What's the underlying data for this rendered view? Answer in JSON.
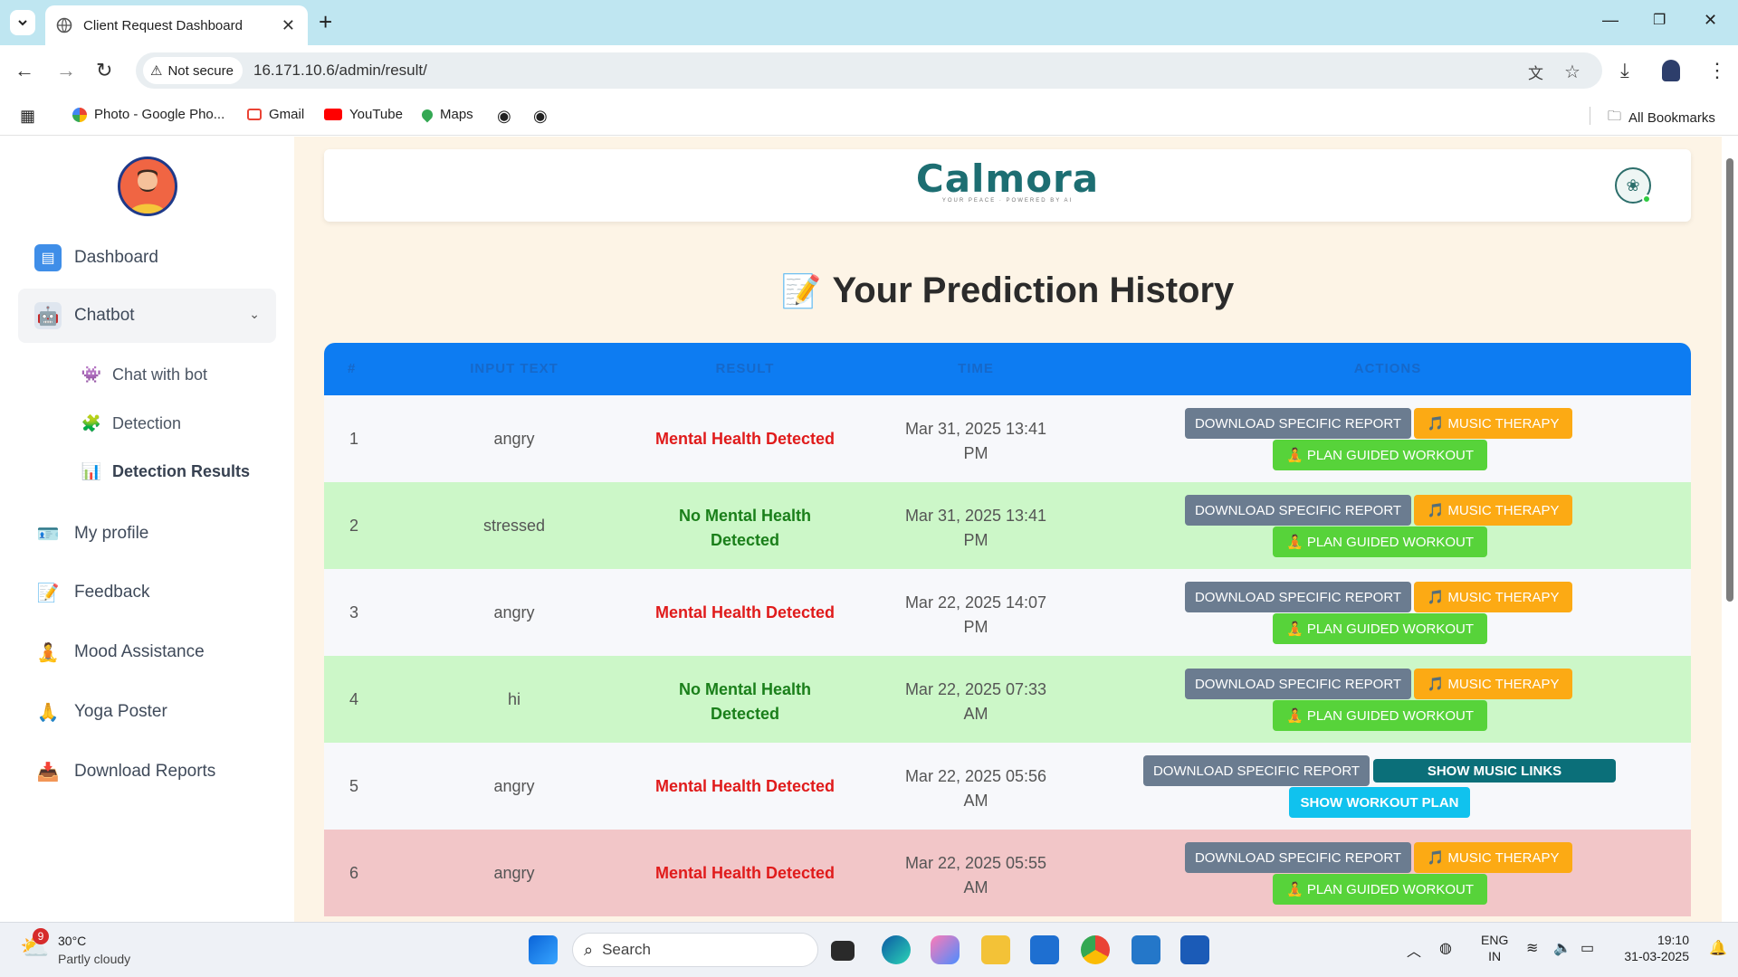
{
  "browser": {
    "tab_title": "Client Request Dashboard",
    "security_label": "Not secure",
    "url": "16.171.10.6/admin/result/",
    "bookmarks": [
      "Photo - Google Pho...",
      "Gmail",
      "YouTube",
      "Maps"
    ],
    "all_bookmarks": "All Bookmarks"
  },
  "sidebar": {
    "items": [
      {
        "label": "Dashboard",
        "icon": "dashboard-icon"
      },
      {
        "label": "Chatbot",
        "icon": "chatbot-icon"
      },
      {
        "label": "My profile",
        "icon": "profile-icon"
      },
      {
        "label": "Feedback",
        "icon": "feedback-icon"
      },
      {
        "label": "Mood Assistance",
        "icon": "mood-icon"
      },
      {
        "label": "Yoga Poster",
        "icon": "yoga-icon"
      },
      {
        "label": "Download Reports",
        "icon": "download-reports-icon"
      }
    ],
    "sub_items": [
      {
        "label": "Chat with bot"
      },
      {
        "label": "Detection"
      },
      {
        "label": "Detection Results"
      }
    ]
  },
  "brand": {
    "name": "Calmora",
    "tagline": "YOUR PEACE · POWERED BY AI"
  },
  "main": {
    "title": "Your Prediction History",
    "columns": [
      "#",
      "INPUT TEXT",
      "RESULT",
      "TIME",
      "ACTIONS"
    ],
    "buttons": {
      "download": "DOWNLOAD SPECIFIC REPORT",
      "music": "🎵 MUSIC THERAPY",
      "workout": "🧘 PLAN GUIDED WORKOUT",
      "music_links": "SHOW MUSIC LINKS",
      "workout_plan": "SHOW WORKOUT PLAN"
    },
    "rows": [
      {
        "num": "1",
        "input": "angry",
        "result_line1": "Mental Health Detected",
        "result_line2": "",
        "time_line1": "Mar 31, 2025 13:41",
        "time_line2": "PM"
      },
      {
        "num": "2",
        "input": "stressed",
        "result_line1": "No Mental Health",
        "result_line2": "Detected",
        "time_line1": "Mar 31, 2025 13:41",
        "time_line2": "PM"
      },
      {
        "num": "3",
        "input": "angry",
        "result_line1": "Mental Health Detected",
        "result_line2": "",
        "time_line1": "Mar 22, 2025 14:07",
        "time_line2": "PM"
      },
      {
        "num": "4",
        "input": "hi",
        "result_line1": "No Mental Health",
        "result_line2": "Detected",
        "time_line1": "Mar 22, 2025 07:33",
        "time_line2": "AM"
      },
      {
        "num": "5",
        "input": "angry",
        "result_line1": "Mental Health Detected",
        "result_line2": "",
        "time_line1": "Mar 22, 2025 05:56",
        "time_line2": "AM"
      },
      {
        "num": "6",
        "input": "angry",
        "result_line1": "Mental Health Detected",
        "result_line2": "",
        "time_line1": "Mar 22, 2025 05:55",
        "time_line2": "AM"
      }
    ]
  },
  "taskbar": {
    "weather_temp": "30°C",
    "weather_desc": "Partly cloudy",
    "weather_badge": "9",
    "search_placeholder": "Search",
    "lang_line1": "ENG",
    "lang_line2": "IN",
    "time": "19:10",
    "date": "31-03-2025"
  },
  "colors": {
    "header_blue": "#0d7cf2",
    "detected_red": "#e01b1b",
    "not_detected_green": "#1a7f1a",
    "row_green": "#ccf7c8",
    "row_red": "#f2c6c8",
    "brand_teal": "#1d6e72"
  }
}
